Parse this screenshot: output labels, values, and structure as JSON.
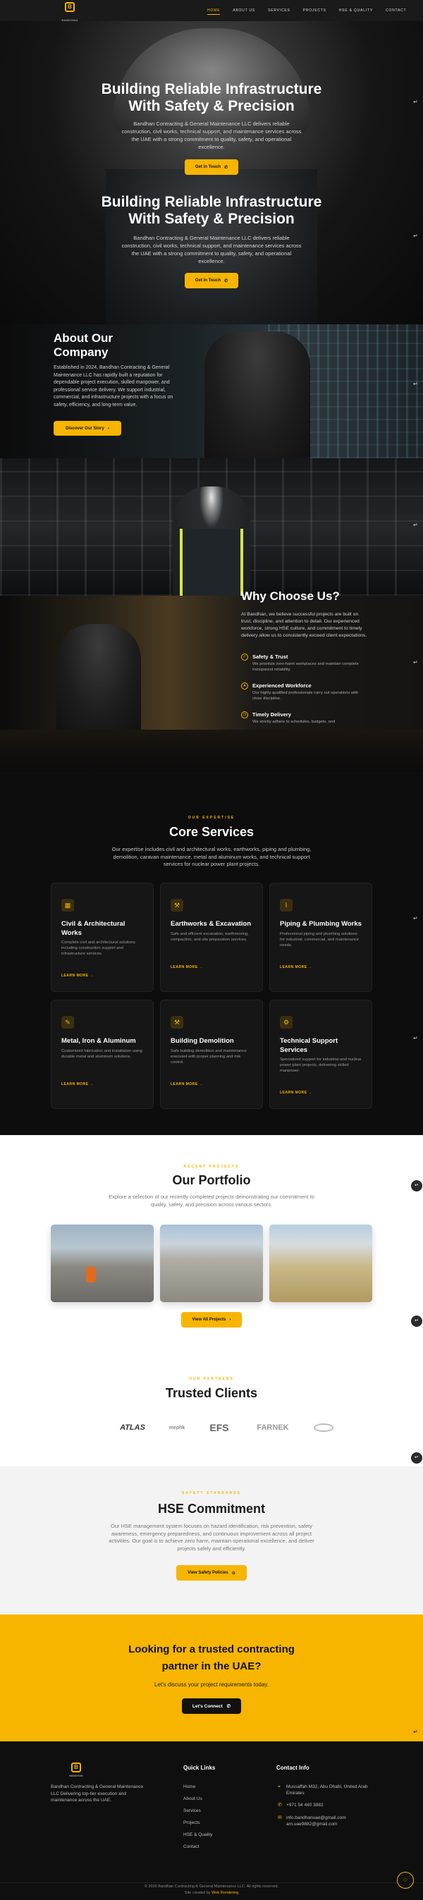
{
  "nav": {
    "logo_text": "BANDHAN",
    "links": [
      "HOME",
      "ABOUT US",
      "SERVICES",
      "PROJECTS",
      "HSE & QUALITY",
      "CONTACT"
    ]
  },
  "hero": {
    "title_line1": "Building Reliable Infrastructure",
    "title_line2": "With Safety & Precision",
    "description": "Bandhan Contracting & General Maintenance LLC delivers reliable construction, civil works, technical support, and maintenance services across the UAE with a strong commitment to quality, safety, and operational excellence.",
    "cta": "Get in Touch"
  },
  "about": {
    "title_line1": "About Our",
    "title_line2": "Company",
    "description": "Established in 2024, Bandhan Contracting & General Maintenance LLC has rapidly built a reputation for dependable project execution, skilled manpower, and professional service delivery. We support industrial, commercial, and infrastructure projects with a focus on safety, efficiency, and long-term value.",
    "cta": "Discover Our Story"
  },
  "why": {
    "title": "Why Choose Us?",
    "description": "At Bandhan, we believe successful projects are built on trust, discipline, and attention to detail. Our experienced workforce, strong HSE culture, and commitment to timely delivery allow us to consistently exceed client expectations.",
    "features": [
      {
        "title": "Safety & Trust",
        "desc": "We prioritize zero-harm workplaces and maintain complete transparent reliability."
      },
      {
        "title": "Experienced Workforce",
        "desc": "Our highly qualified professionals carry out operations with close discipline."
      },
      {
        "title": "Timely Delivery",
        "desc": "We strictly adhere to schedules, budgets, and"
      }
    ]
  },
  "services": {
    "eyebrow": "OUR EXPERTISE",
    "title": "Core Services",
    "description": "Our expertise includes civil and architectural works, earthworks, piping and plumbing, demolition, caravan maintenance, metal and aluminum works, and technical support services for nuclear power plant projects.",
    "learn_more": "LEARN MORE →",
    "cards": [
      {
        "icon": "building-icon",
        "title": "Civil & Architectural Works",
        "desc": "Complete civil and architectural solutions including construction support and infrastructure services."
      },
      {
        "icon": "excavator-icon",
        "title": "Earthworks & Excavation",
        "desc": "Safe and efficient excavation, earthmoving, compaction, and site preparation services."
      },
      {
        "icon": "pipe-icon",
        "title": "Piping & Plumbing Works",
        "desc": "Professional piping and plumbing solutions for industrial, commercial, and maintenance needs."
      },
      {
        "icon": "wrench-icon",
        "title": "Metal, Iron & Aluminum",
        "desc": "Customized fabrication and installation using durable metal and aluminum solutions."
      },
      {
        "icon": "hammer-icon",
        "title": "Building Demolition",
        "desc": "Safe building demolition and maintenance executed with proper planning and risk control."
      },
      {
        "icon": "gear-icon",
        "title": "Technical Support Services",
        "desc": "Specialized support for industrial and nuclear power plant projects, delivering skilled manpower."
      }
    ]
  },
  "portfolio": {
    "eyebrow": "RECENT PROJECTS",
    "title": "Our Portfolio",
    "description": "Explore a selection of our recently completed projects demonstrating our commitment to quality, safety, and precision across various sectors.",
    "cta": "View All Projects"
  },
  "clients": {
    "eyebrow": "OUR PARTNERS",
    "title": "Trusted Clients",
    "logos": [
      "",
      "ATLAS",
      "mephk",
      "EFS",
      "FARNEK",
      "",
      ""
    ]
  },
  "hse": {
    "eyebrow": "SAFETY STANDARDS",
    "title": "HSE Commitment",
    "description": "Our HSE management system focuses on hazard identification, risk prevention, safety awareness, emergency preparedness, and continuous improvement across all project activities. Our goal is to achieve zero harm, maintain operational excellence, and deliver projects safely and efficiently.",
    "cta": "View Safety Policies"
  },
  "cta": {
    "title_line1": "Looking for a trusted contracting",
    "title_line2": "partner in the UAE?",
    "subtitle": "Let's discuss your project requirements today.",
    "button": "Let's Connect"
  },
  "footer": {
    "about": "Bandhan Contracting & General Maintenance LLC Delivering top-tier execution and maintenance across the UAE.",
    "quick_links_title": "Quick Links",
    "quick_links": [
      "Home",
      "About Us",
      "Services",
      "Projects",
      "HSE & Quality",
      "Contact"
    ],
    "contact_title": "Contact Info",
    "address": "Mussaffah M32, Abu Dhabi, United Arab Emirates",
    "phone": "+971 54 440 3882",
    "email1": "info.bandhanuae@gmail.com",
    "email2": "am.uae9882@gmail.com",
    "copyright": "© 2026 Bandhan Contracting & General Maintenance LLC. All rights reserved.",
    "credit_prefix": "Site created by",
    "credit_name": "Web Rendering"
  },
  "colors": {
    "accent": "#f7b500",
    "dark": "#0d0d0d",
    "light": "#ffffff"
  }
}
